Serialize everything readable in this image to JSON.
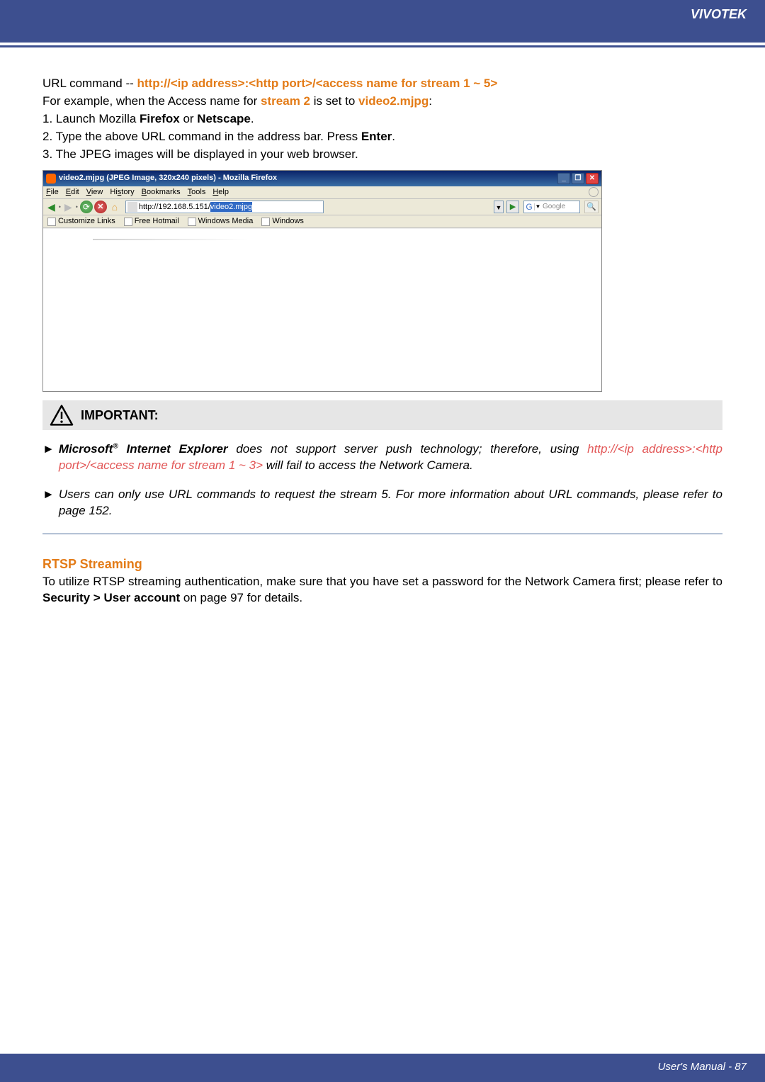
{
  "header": {
    "brand": "VIVOTEK"
  },
  "url_section": {
    "line1_prefix": "URL command -- ",
    "line1_cmd": "http://<ip address>:<http port>/<access name for stream 1 ~ 5>",
    "line2_a": "For example, when the Access name for ",
    "line2_b": "stream 2",
    "line2_c": " is set to ",
    "line2_d": "video2.mjpg",
    "line2_e": ":",
    "step1_a": "1. Launch Mozilla ",
    "step1_b": "Firefox",
    "step1_c": " or ",
    "step1_d": "Netscape",
    "step1_e": ".",
    "step2_a": "2. Type the above URL command in the address bar. Press ",
    "step2_b": "Enter",
    "step2_c": ".",
    "step3": "3. The JPEG images will be displayed in your web browser."
  },
  "firefox": {
    "title": "video2.mjpg (JPEG Image, 320x240 pixels) - Mozilla Firefox",
    "win": {
      "min": "_",
      "max": "❐",
      "close": "✕"
    },
    "menus": [
      "File",
      "Edit",
      "View",
      "History",
      "Bookmarks",
      "Tools",
      "Help"
    ],
    "url_plain": "http://192.168.5.151/",
    "url_sel": "video2.mjpg",
    "dropdown_glyph": "▼",
    "go_glyph": "▶",
    "search_placeholder": "Google",
    "loupe": "🔍",
    "back_glyph": "◀",
    "fwd_glyph": "▶",
    "sep": "•",
    "reload_glyph": "⟳",
    "stop_glyph": "✕",
    "home_glyph": "⌂",
    "bookmarks": [
      "Customize Links",
      "Free Hotmail",
      "Windows Media",
      "Windows"
    ]
  },
  "important": {
    "heading": "IMPORTANT:",
    "b1_marker": "►",
    "b1_a": "Microsoft",
    "b1_reg": "®",
    "b1_b": " Internet Explorer",
    "b1_c": " does not support server push technology; therefore, using ",
    "b1_d": "http://<ip address>:<http port>/<access name for stream 1 ~ 3>",
    "b1_e": " will fail to access the Network Camera.",
    "b2_marker": "►",
    "b2": "Users can only use URL commands to request the stream 5. For more information about URL commands, please refer to page 152."
  },
  "rtsp": {
    "heading": "RTSP Streaming",
    "body_a": "To utilize RTSP streaming authentication, make sure that you have set a password for the Network Camera first; please refer to ",
    "body_b": "Security > User account",
    "body_c": " on page 97 for details."
  },
  "footer": {
    "text": "User's Manual - 87"
  }
}
